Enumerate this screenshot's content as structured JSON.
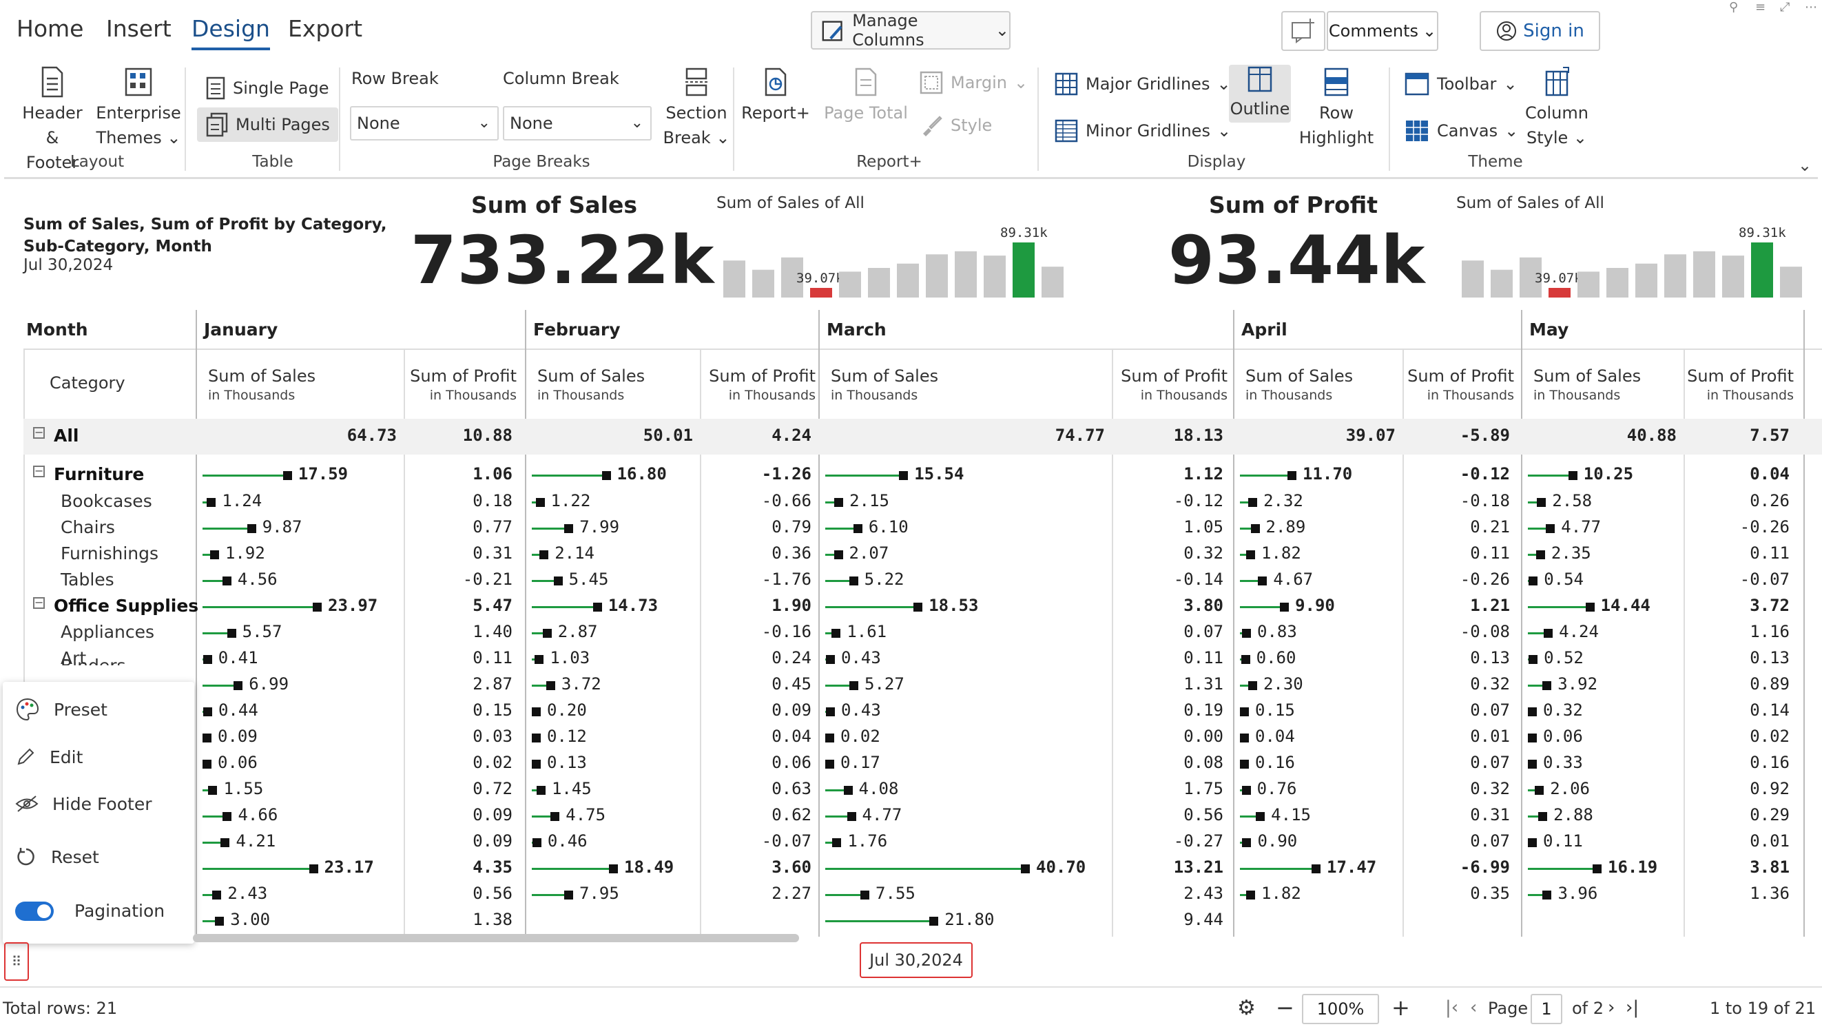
{
  "nav": {
    "tabs": [
      "Home",
      "Insert",
      "Design",
      "Export"
    ],
    "active_tab": "Design",
    "manage_columns": "Manage Columns",
    "comments": "Comments",
    "sign_in": "Sign in"
  },
  "ribbon": {
    "layout": {
      "label": "Layout",
      "header_footer_1": "Header",
      "header_footer_2": "& Footer",
      "themes_1": "Enterprise",
      "themes_2": "Themes"
    },
    "table": {
      "label": "Table",
      "single_page": "Single Page",
      "multi_pages": "Multi Pages"
    },
    "page_breaks": {
      "label": "Page Breaks",
      "row_break": "Row Break",
      "column_break": "Column Break",
      "row_break_value": "None",
      "column_break_value": "None",
      "section_1": "Section",
      "section_2": "Break"
    },
    "report_plus": {
      "label": "Report+",
      "report_plus_btn": "Report+",
      "page_total_1": "Page Total",
      "margin": "Margin",
      "style": "Style"
    },
    "display": {
      "label": "Display",
      "major": "Major Gridlines",
      "minor": "Minor Gridlines",
      "outline": "Outline",
      "row_highlight_1": "Row",
      "row_highlight_2": "Highlight"
    },
    "theme": {
      "label": "Theme",
      "toolbar": "Toolbar",
      "canvas": "Canvas",
      "column_style_1": "Column",
      "column_style_2": "Style"
    }
  },
  "report": {
    "title_line1": "Sum of Sales, Sum of Profit by Category,",
    "title_line2": "Sub-Category, Month",
    "date": "Jul 30,2024"
  },
  "kpis": [
    {
      "name": "Sum of Sales",
      "value": "733.22k",
      "spark_title": "Sum of Sales of All",
      "max_label": "89.31k",
      "min_label": "39.07k",
      "spark_values": [
        60,
        45,
        65,
        39.07,
        42,
        48,
        55,
        70,
        75,
        68,
        89.31,
        50
      ],
      "max_color": "#1e9a40",
      "min_color": "#d73a3a",
      "bar_color": "#c9c9c9"
    },
    {
      "name": "Sum of Profit",
      "value": "93.44k",
      "spark_title": "Sum of Sales of All",
      "max_label": "89.31k",
      "min_label": "39.07k",
      "spark_values": [
        60,
        45,
        65,
        39.07,
        42,
        48,
        55,
        70,
        75,
        68,
        89.31,
        50
      ],
      "max_color": "#1e9a40",
      "min_color": "#d73a3a",
      "bar_color": "#c9c9c9"
    }
  ],
  "table": {
    "month_header": "Month",
    "category_header": "Category",
    "months": [
      "January",
      "February",
      "March",
      "April",
      "May"
    ],
    "col_sales": "Sum of Sales",
    "col_profit": "Sum of Profit",
    "col_unit": "in Thousands",
    "rows": [
      {
        "label": "All",
        "level": 0,
        "bold": true,
        "expand": true,
        "bar": false,
        "sales": [
          "64.73",
          "50.01",
          "74.77",
          "39.07",
          "40.88"
        ],
        "profit": [
          "10.88",
          "4.24",
          "18.13",
          "-5.89",
          "7.57"
        ]
      },
      {
        "label": "Furniture",
        "level": 0,
        "bold": true,
        "expand": true,
        "bar": true,
        "sales": [
          "17.59",
          "16.80",
          "15.54",
          "11.70",
          "10.25"
        ],
        "profit": [
          "1.06",
          "-1.26",
          "1.12",
          "-0.12",
          "0.04"
        ]
      },
      {
        "label": "Bookcases",
        "level": 1,
        "bold": false,
        "bar": true,
        "sales": [
          "1.24",
          "1.22",
          "2.15",
          "2.32",
          "2.58"
        ],
        "profit": [
          "0.18",
          "-0.66",
          "-0.12",
          "-0.18",
          "0.26"
        ]
      },
      {
        "label": "Chairs",
        "level": 1,
        "bold": false,
        "bar": true,
        "sales": [
          "9.87",
          "7.99",
          "6.10",
          "2.89",
          "4.77"
        ],
        "profit": [
          "0.77",
          "0.79",
          "1.05",
          "0.21",
          "-0.26"
        ]
      },
      {
        "label": "Furnishings",
        "level": 1,
        "bold": false,
        "bar": true,
        "sales": [
          "1.92",
          "2.14",
          "2.07",
          "1.82",
          "2.35"
        ],
        "profit": [
          "0.31",
          "0.36",
          "0.32",
          "0.11",
          "0.11"
        ]
      },
      {
        "label": "Tables",
        "level": 1,
        "bold": false,
        "bar": true,
        "sales": [
          "4.56",
          "5.45",
          "5.22",
          "4.67",
          "0.54"
        ],
        "profit": [
          "-0.21",
          "-1.76",
          "-0.14",
          "-0.26",
          "-0.07"
        ]
      },
      {
        "label": "Office Supplies",
        "level": 0,
        "bold": true,
        "expand": true,
        "bar": true,
        "sales": [
          "23.97",
          "14.73",
          "18.53",
          "9.90",
          "14.44"
        ],
        "profit": [
          "5.47",
          "1.90",
          "3.80",
          "1.21",
          "3.72"
        ]
      },
      {
        "label": "Appliances",
        "level": 1,
        "bold": false,
        "bar": true,
        "sales": [
          "5.57",
          "2.87",
          "1.61",
          "0.83",
          "4.24"
        ],
        "profit": [
          "1.40",
          "-0.16",
          "0.07",
          "-0.08",
          "1.16"
        ]
      },
      {
        "label": "Art",
        "level": 1,
        "bold": false,
        "bar": true,
        "sales": [
          "0.41",
          "1.03",
          "0.43",
          "0.60",
          "0.52"
        ],
        "profit": [
          "0.11",
          "0.24",
          "0.11",
          "0.13",
          "0.13"
        ]
      },
      {
        "label": "",
        "level": 1,
        "bold": false,
        "bar": true,
        "sales": [
          "6.99",
          "3.72",
          "5.27",
          "2.30",
          "3.92"
        ],
        "profit": [
          "2.87",
          "0.45",
          "1.31",
          "0.32",
          "0.89"
        ]
      },
      {
        "label": "",
        "level": 1,
        "bold": false,
        "bar": true,
        "sales": [
          "0.44",
          "0.20",
          "0.43",
          "0.15",
          "0.32"
        ],
        "profit": [
          "0.15",
          "0.09",
          "0.19",
          "0.07",
          "0.14"
        ]
      },
      {
        "label": "",
        "level": 1,
        "bold": false,
        "bar": true,
        "sales": [
          "0.09",
          "0.12",
          "0.02",
          "0.04",
          "0.06"
        ],
        "profit": [
          "0.03",
          "0.04",
          "0.00",
          "0.01",
          "0.02"
        ]
      },
      {
        "label": "",
        "level": 1,
        "bold": false,
        "bar": true,
        "sales": [
          "0.06",
          "0.13",
          "0.17",
          "0.16",
          "0.33"
        ],
        "profit": [
          "0.02",
          "0.06",
          "0.08",
          "0.07",
          "0.16"
        ]
      },
      {
        "label": "",
        "level": 1,
        "bold": false,
        "bar": true,
        "sales": [
          "1.55",
          "1.45",
          "4.08",
          "0.76",
          "2.06"
        ],
        "profit": [
          "0.72",
          "0.63",
          "1.75",
          "0.32",
          "0.92"
        ]
      },
      {
        "label": "",
        "level": 1,
        "bold": false,
        "bar": true,
        "sales": [
          "4.66",
          "4.75",
          "4.77",
          "4.15",
          "2.88"
        ],
        "profit": [
          "0.09",
          "0.62",
          "0.56",
          "0.31",
          "0.29"
        ]
      },
      {
        "label": "",
        "level": 1,
        "bold": false,
        "bar": true,
        "sales": [
          "4.21",
          "0.46",
          "1.76",
          "0.90",
          "0.11"
        ],
        "profit": [
          "0.09",
          "-0.07",
          "-0.27",
          "0.07",
          "0.01"
        ]
      },
      {
        "label": "",
        "level": 0,
        "bold": true,
        "bar": true,
        "sales": [
          "23.17",
          "18.49",
          "40.70",
          "17.47",
          "16.19"
        ],
        "profit": [
          "4.35",
          "3.60",
          "13.21",
          "-6.99",
          "3.81"
        ]
      },
      {
        "label": "",
        "level": 1,
        "bold": false,
        "bar": true,
        "sales": [
          "2.43",
          "7.95",
          "7.55",
          "1.82",
          "3.96"
        ],
        "profit": [
          "0.56",
          "2.27",
          "2.43",
          "0.35",
          "1.36"
        ]
      },
      {
        "label": "",
        "level": 1,
        "bold": false,
        "bar": true,
        "sales": [
          "3.00",
          "",
          "21.80",
          "",
          ""
        ],
        "profit": [
          "1.38",
          "",
          "9.44",
          "",
          ""
        ]
      }
    ],
    "partial_binders_label": "Binders"
  },
  "popup_menu": {
    "preset": "Preset",
    "edit": "Edit",
    "hide_footer": "Hide Footer",
    "reset": "Reset",
    "pagination": "Pagination",
    "pagination_on": true
  },
  "footer": {
    "date": "Jul 30,2024"
  },
  "status": {
    "total_rows": "Total rows: 21",
    "zoom": "100%",
    "page_label": "Page",
    "page_number": "1",
    "page_of": "of 2",
    "range": "1 to 19 of 21"
  }
}
